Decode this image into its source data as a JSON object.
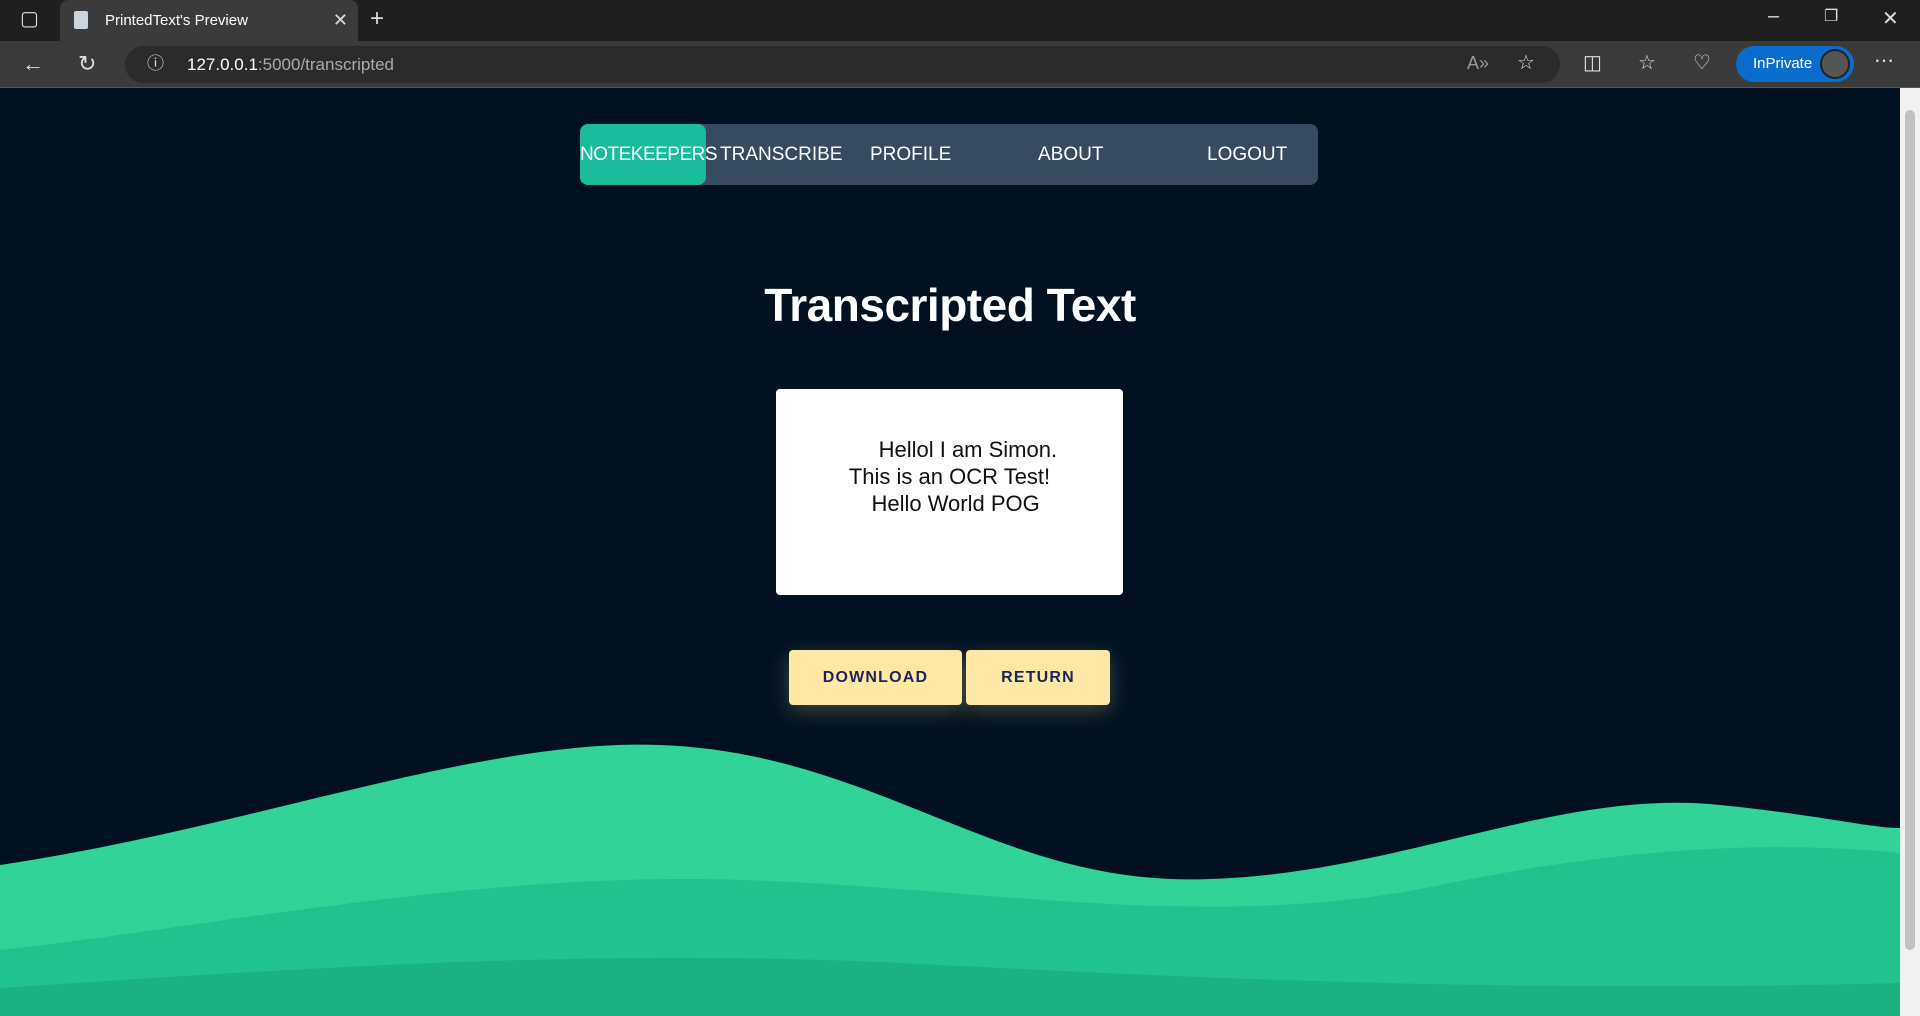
{
  "browser": {
    "tab_title": "PrintedText's Preview",
    "url_host": "127.0.0.1",
    "url_rest": ":5000/transcripted",
    "inprivate_label": "InPrivate"
  },
  "nav": {
    "items": [
      {
        "label": "NOTEKEEPERS",
        "active": true
      },
      {
        "label": "TRANSCRIBE"
      },
      {
        "label": "PROFILE"
      },
      {
        "label": "ABOUT"
      },
      {
        "label": "LOGOUT"
      }
    ]
  },
  "page": {
    "title": "Transcripted Text",
    "transcript": "      Hellol I am Simon.\nThis is an OCR Test!\n  Hello World POG"
  },
  "buttons": {
    "download": "DOWNLOAD",
    "return": "RETURN"
  },
  "colors": {
    "background": "#011120",
    "nav": "#374a5f",
    "accent": "#1abc9c",
    "button": "#ffe8a3",
    "wave1": "#31d398",
    "wave2": "#22c28e",
    "wave3": "#1bb282"
  }
}
